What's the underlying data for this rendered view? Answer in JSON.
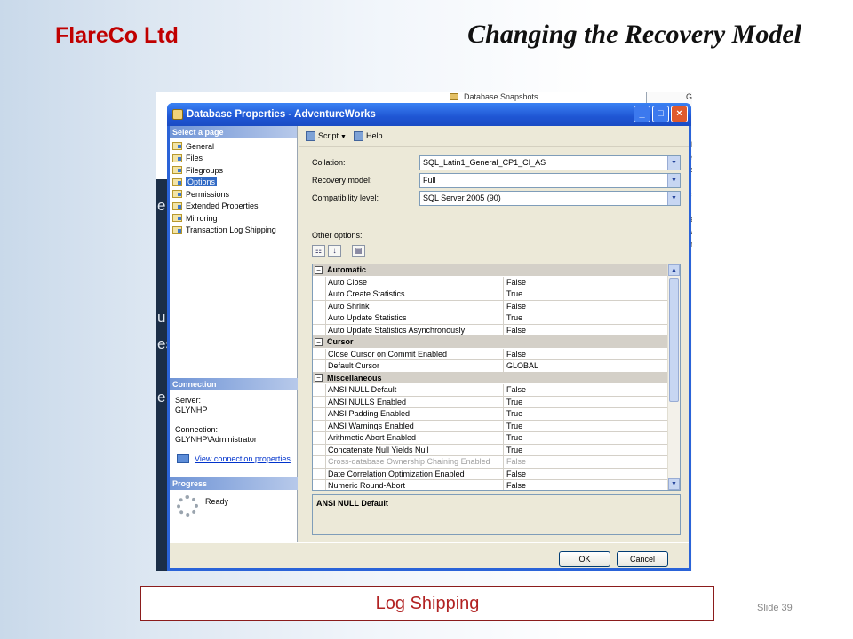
{
  "slide": {
    "brand": "FlareCo Ltd",
    "title": "Changing the Recovery Model",
    "footer": "Log Shipping",
    "slide_number": "Slide 39"
  },
  "background_app": {
    "tree_item": "Database Snapshots",
    "left_fragments": [
      "e",
      "u",
      "es",
      "e"
    ],
    "right_fragments": [
      "G",
      "el",
      "le",
      "es",
      "o",
      "ic",
      "tr",
      "ge",
      "W",
      "ar"
    ]
  },
  "window": {
    "title": "Database Properties - AdventureWorks",
    "buttons": {
      "minimize": "_",
      "maximize": "□",
      "close": "×"
    }
  },
  "left_pane": {
    "select_page_header": "Select a page",
    "pages": [
      {
        "label": "General",
        "selected": false
      },
      {
        "label": "Files",
        "selected": false
      },
      {
        "label": "Filegroups",
        "selected": false
      },
      {
        "label": "Options",
        "selected": true
      },
      {
        "label": "Permissions",
        "selected": false
      },
      {
        "label": "Extended Properties",
        "selected": false
      },
      {
        "label": "Mirroring",
        "selected": false
      },
      {
        "label": "Transaction Log Shipping",
        "selected": false
      }
    ],
    "connection_header": "Connection",
    "server_label": "Server:",
    "server_value": "GLYNHP",
    "connection_label": "Connection:",
    "connection_value": "GLYNHP\\Administrator",
    "view_connection_link": "View connection properties",
    "progress_header": "Progress",
    "progress_status": "Ready"
  },
  "toolbar": {
    "script_label": "Script",
    "help_label": "Help"
  },
  "form": {
    "collation_label": "Collation:",
    "collation_value": "SQL_Latin1_General_CP1_CI_AS",
    "recovery_label": "Recovery model:",
    "recovery_value": "Full",
    "compat_label": "Compatibility level:",
    "compat_value": "SQL Server 2005 (90)",
    "other_options_label": "Other options:"
  },
  "grid": {
    "categories": [
      {
        "name": "Automatic",
        "rows": [
          {
            "name": "Auto Close",
            "value": "False"
          },
          {
            "name": "Auto Create Statistics",
            "value": "True"
          },
          {
            "name": "Auto Shrink",
            "value": "False"
          },
          {
            "name": "Auto Update Statistics",
            "value": "True"
          },
          {
            "name": "Auto Update Statistics Asynchronously",
            "value": "False"
          }
        ]
      },
      {
        "name": "Cursor",
        "rows": [
          {
            "name": "Close Cursor on Commit Enabled",
            "value": "False"
          },
          {
            "name": "Default Cursor",
            "value": "GLOBAL"
          }
        ]
      },
      {
        "name": "Miscellaneous",
        "rows": [
          {
            "name": "ANSI NULL Default",
            "value": "False"
          },
          {
            "name": "ANSI NULLS Enabled",
            "value": "True"
          },
          {
            "name": "ANSI Padding Enabled",
            "value": "True"
          },
          {
            "name": "ANSI Warnings Enabled",
            "value": "True"
          },
          {
            "name": "Arithmetic Abort Enabled",
            "value": "True"
          },
          {
            "name": "Concatenate Null Yields Null",
            "value": "True"
          },
          {
            "name": "Cross-database Ownership Chaining Enabled",
            "value": "False",
            "disabled": true
          },
          {
            "name": "Date Correlation Optimization Enabled",
            "value": "False"
          },
          {
            "name": "Numeric Round-Abort",
            "value": "False"
          }
        ]
      }
    ],
    "description_title": "ANSI NULL Default"
  },
  "dialog_buttons": {
    "ok": "OK",
    "cancel": "Cancel"
  }
}
